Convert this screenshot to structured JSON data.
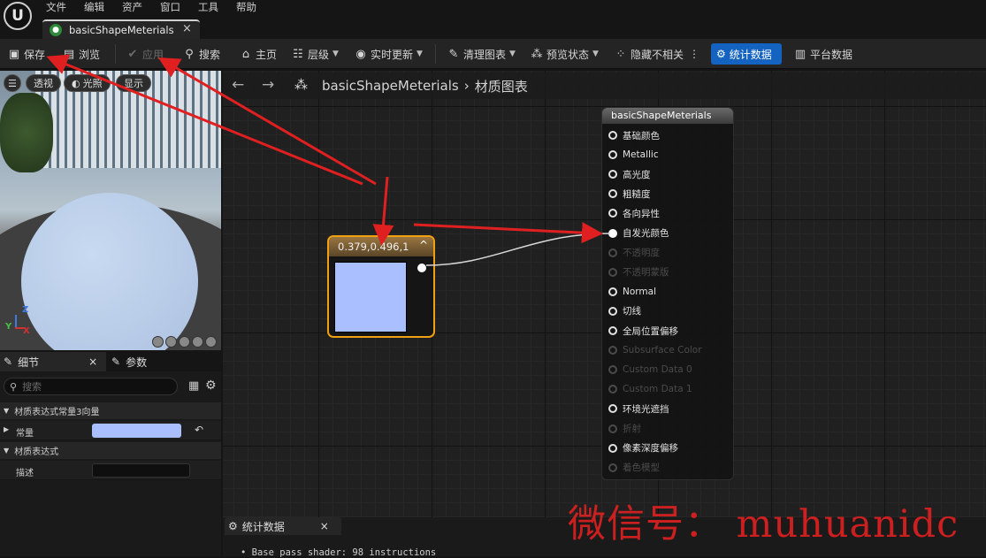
{
  "menubar": {
    "logo": "U",
    "items": [
      "文件",
      "编辑",
      "资产",
      "窗口",
      "工具",
      "帮助"
    ]
  },
  "tab": {
    "title": "basicShapeMeterials",
    "close": "×"
  },
  "toolbar": {
    "save": "保存",
    "browse": "浏览",
    "apply": "应用",
    "search": "搜索",
    "home": "主页",
    "hierarchy": "层级",
    "live_update": "实时更新",
    "clean_graph": "清理图表",
    "preview_state": "预览状态",
    "hide_unrelated": "隐藏不相关",
    "stats": "统计数据",
    "platform_stats": "平台数据"
  },
  "viewport": {
    "perspective": "透视",
    "lit": "光照",
    "show": "显示",
    "axis_z": "Z",
    "axis_y": "Y",
    "axis_x": "X"
  },
  "details": {
    "tab_details": "细节",
    "tab_params": "参数",
    "search_placeholder": "搜索",
    "section_constant": "材质表达式常量3向量",
    "row_constant": "常量",
    "section_expression": "材质表达式",
    "row_desc": "描述",
    "constant_color": "#a9bfff"
  },
  "breadcrumb": {
    "asset": "basicShapeMeterials",
    "graph": "材质图表"
  },
  "constant_node": {
    "title": "0.379,0.496,1",
    "preview_color": "#a9bfff"
  },
  "material_node": {
    "title": "basicShapeMeterials",
    "pins": [
      {
        "label": "基础颜色",
        "enabled": true,
        "connected": false
      },
      {
        "label": "Metallic",
        "enabled": true,
        "connected": false
      },
      {
        "label": "高光度",
        "enabled": true,
        "connected": false
      },
      {
        "label": "粗糙度",
        "enabled": true,
        "connected": false
      },
      {
        "label": "各向异性",
        "enabled": true,
        "connected": false
      },
      {
        "label": "自发光颜色",
        "enabled": true,
        "connected": true
      },
      {
        "label": "不透明度",
        "enabled": false,
        "connected": false
      },
      {
        "label": "不透明蒙版",
        "enabled": false,
        "connected": false
      },
      {
        "label": "Normal",
        "enabled": true,
        "connected": false
      },
      {
        "label": "切线",
        "enabled": true,
        "connected": false
      },
      {
        "label": "全局位置偏移",
        "enabled": true,
        "connected": false
      },
      {
        "label": "Subsurface Color",
        "enabled": false,
        "connected": false
      },
      {
        "label": "Custom Data 0",
        "enabled": false,
        "connected": false
      },
      {
        "label": "Custom Data 1",
        "enabled": false,
        "connected": false
      },
      {
        "label": "环境光遮挡",
        "enabled": true,
        "connected": false
      },
      {
        "label": "折射",
        "enabled": false,
        "connected": false
      },
      {
        "label": "像素深度偏移",
        "enabled": true,
        "connected": false
      },
      {
        "label": "着色模型",
        "enabled": false,
        "connected": false
      }
    ]
  },
  "stats_panel": {
    "tab": "统计数据",
    "close": "×",
    "line": "• Base pass shader: 98 instructions"
  },
  "watermark": "微信号： muhuanidc",
  "colors": {
    "accent": "#1463c0",
    "node_border": "#f0a010",
    "annotation": "#e02020"
  }
}
